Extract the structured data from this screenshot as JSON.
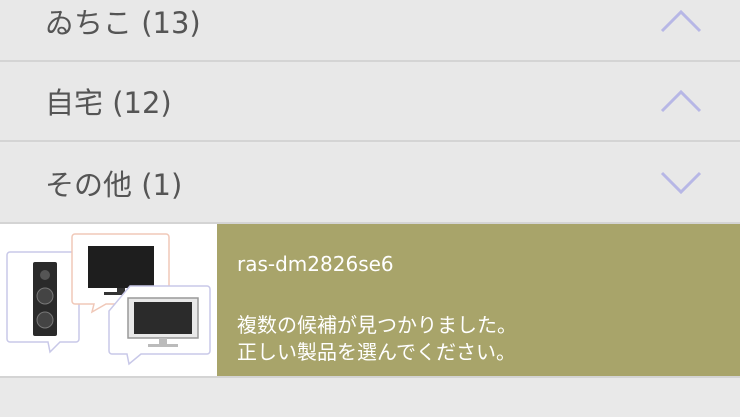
{
  "colors": {
    "background": "#e9e9e9",
    "row_text": "#555555",
    "chevron": "#b7b7e6",
    "divider": "#d4d4d4",
    "selected_row": "#a8a46a",
    "selected_text": "#ffffff"
  },
  "groups": [
    {
      "label": "ゐちこ (13)",
      "state": "expanded",
      "icon": "chevron-up-icon"
    },
    {
      "label": "自宅 (12)",
      "state": "expanded",
      "icon": "chevron-up-icon"
    },
    {
      "label": "その他 (1)",
      "state": "collapsed",
      "icon": "chevron-down-icon"
    }
  ],
  "device": {
    "model": "ras-dm2826se6",
    "message_line1": "複数の候補が見つかりました。",
    "message_line2": "正しい製品を選んでください。",
    "thumbnail_icon": "multiple-devices-icon"
  }
}
